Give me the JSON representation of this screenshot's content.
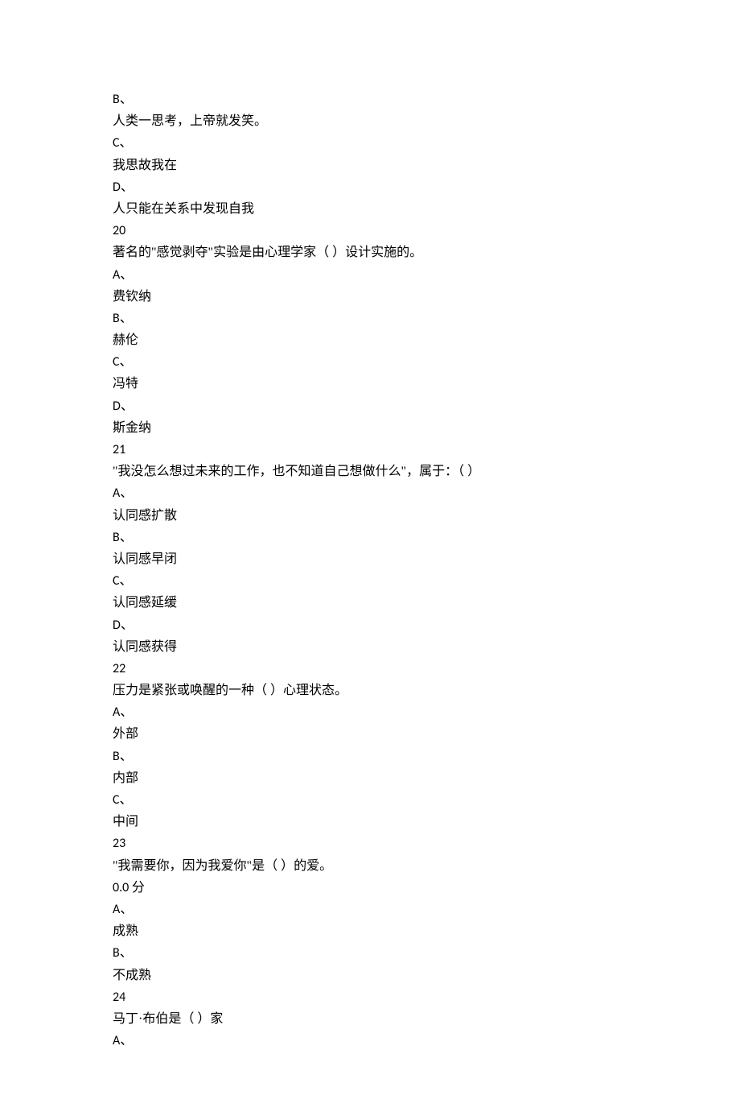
{
  "lines": [
    {
      "text": "B、",
      "latin": true
    },
    {
      "text": "人类一思考，上帝就发笑。"
    },
    {
      "text": "C、",
      "latin": true
    },
    {
      "text": "我思故我在"
    },
    {
      "text": "D、",
      "latin": true
    },
    {
      "text": "人只能在关系中发现自我"
    },
    {
      "text": "20",
      "latin": true
    },
    {
      "text": "著名的\"感觉剥夺\"实验是由心理学家（ ）设计实施的。"
    },
    {
      "text": "A、",
      "latin": true
    },
    {
      "text": "费钦纳"
    },
    {
      "text": "B、",
      "latin": true
    },
    {
      "text": "赫伦"
    },
    {
      "text": "C、",
      "latin": true
    },
    {
      "text": "冯特"
    },
    {
      "text": "D、",
      "latin": true
    },
    {
      "text": "斯金纳"
    },
    {
      "text": "21",
      "latin": true
    },
    {
      "text": "\"我没怎么想过未来的工作，也不知道自己想做什么\"，属于：（ ）"
    },
    {
      "text": "A、",
      "latin": true
    },
    {
      "text": "认同感扩散"
    },
    {
      "text": "B、",
      "latin": true
    },
    {
      "text": "认同感早闭"
    },
    {
      "text": "C、",
      "latin": true
    },
    {
      "text": "认同感延缓"
    },
    {
      "text": "D、",
      "latin": true
    },
    {
      "text": "认同感获得"
    },
    {
      "text": "22",
      "latin": true
    },
    {
      "text": "压力是紧张或唤醒的一种（ ）心理状态。"
    },
    {
      "text": "A、",
      "latin": true
    },
    {
      "text": "外部"
    },
    {
      "text": "B、",
      "latin": true
    },
    {
      "text": "内部"
    },
    {
      "text": "C、",
      "latin": true
    },
    {
      "text": "中间"
    },
    {
      "text": "23",
      "latin": true
    },
    {
      "text": "\"我需要你，因为我爱你\"是（ ）的爱。"
    },
    {
      "text": "0.0 分",
      "latin": true
    },
    {
      "text": "A、",
      "latin": true
    },
    {
      "text": "成熟"
    },
    {
      "text": "B、",
      "latin": true
    },
    {
      "text": "不成熟"
    },
    {
      "text": "24",
      "latin": true
    },
    {
      "text": "马丁·布伯是（ ）家"
    },
    {
      "text": "A、",
      "latin": true
    }
  ]
}
